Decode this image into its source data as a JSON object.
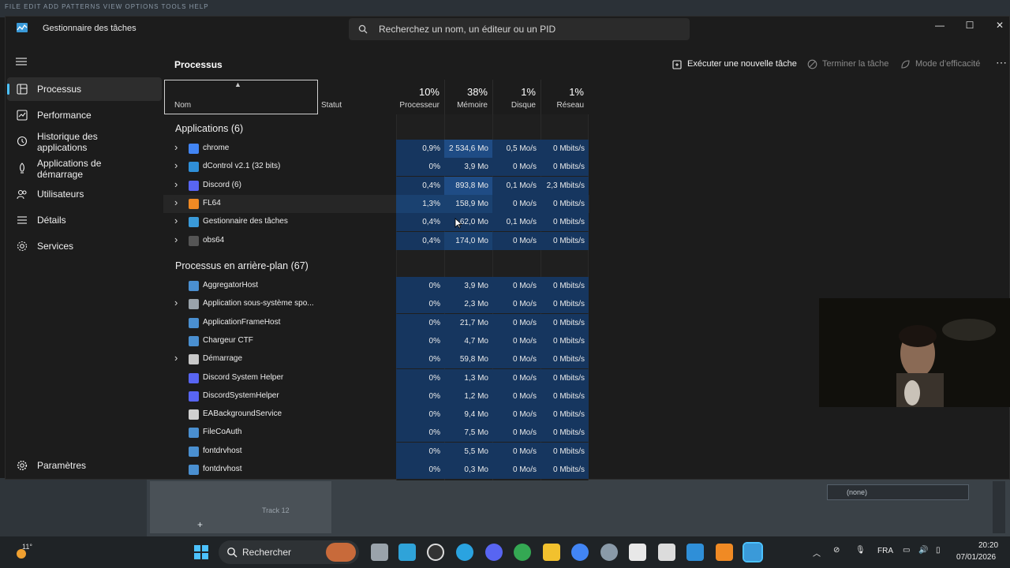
{
  "window": {
    "title": "Gestionnaire des tâches"
  },
  "search": {
    "placeholder": "Recherchez un nom, un éditeur ou un PID"
  },
  "sidebar": {
    "items": [
      {
        "label": "Processus",
        "icon": "processes-icon"
      },
      {
        "label": "Performance",
        "icon": "performance-icon"
      },
      {
        "label": "Historique des applications",
        "icon": "history-icon"
      },
      {
        "label": "Applications de démarrage",
        "icon": "startup-icon"
      },
      {
        "label": "Utilisateurs",
        "icon": "users-icon"
      },
      {
        "label": "Détails",
        "icon": "details-icon"
      },
      {
        "label": "Services",
        "icon": "services-icon"
      }
    ],
    "settings": "Paramètres"
  },
  "page": {
    "title": "Processus",
    "new_task": "Exécuter une nouvelle tâche",
    "end_task": "Terminer la tâche",
    "efficiency": "Mode d’efficacité"
  },
  "columns": {
    "name": "Nom",
    "status": "Statut",
    "cpu_pct": "10%",
    "cpu": "Processeur",
    "mem_pct": "38%",
    "mem": "Mémoire",
    "disk_pct": "1%",
    "disk": "Disque",
    "net_pct": "1%",
    "net": "Réseau"
  },
  "groups": {
    "apps": "Applications (6)",
    "background": "Processus en arrière-plan (67)"
  },
  "apps": [
    {
      "name": "chrome",
      "cpu": "0,9%",
      "mem": "2 534,6 Mo",
      "disk": "0,5 Mo/s",
      "net": "0 Mbits/s",
      "color": "#4285f4"
    },
    {
      "name": "dControl v2.1 (32 bits)",
      "cpu": "0%",
      "mem": "3,9 Mo",
      "disk": "0 Mo/s",
      "net": "0 Mbits/s",
      "color": "#2f8fd8"
    },
    {
      "name": "Discord (6)",
      "cpu": "0,4%",
      "mem": "893,8 Mo",
      "disk": "0,1 Mo/s",
      "net": "2,3 Mbits/s",
      "color": "#5865f2"
    },
    {
      "name": "FL64",
      "cpu": "1,3%",
      "mem": "158,9 Mo",
      "disk": "0 Mo/s",
      "net": "0 Mbits/s",
      "color": "#f08a24"
    },
    {
      "name": "Gestionnaire des tâches",
      "cpu": "0,4%",
      "mem": "62,0 Mo",
      "disk": "0,1 Mo/s",
      "net": "0 Mbits/s",
      "color": "#3a9ad9"
    },
    {
      "name": "obs64",
      "cpu": "0,4%",
      "mem": "174,0 Mo",
      "disk": "0 Mo/s",
      "net": "0 Mbits/s",
      "color": "#555"
    }
  ],
  "background": [
    {
      "name": "AggregatorHost",
      "cpu": "0%",
      "mem": "3,9 Mo",
      "disk": "0 Mo/s",
      "net": "0 Mbits/s",
      "color": "#4a8fd0"
    },
    {
      "name": "Application sous-système spo...",
      "cpu": "0%",
      "mem": "2,3 Mo",
      "disk": "0 Mo/s",
      "net": "0 Mbits/s",
      "color": "#9aa3ab"
    },
    {
      "name": "ApplicationFrameHost",
      "cpu": "0%",
      "mem": "21,7 Mo",
      "disk": "0 Mo/s",
      "net": "0 Mbits/s",
      "color": "#4a8fd0"
    },
    {
      "name": "Chargeur CTF",
      "cpu": "0%",
      "mem": "4,7 Mo",
      "disk": "0 Mo/s",
      "net": "0 Mbits/s",
      "color": "#4a8fd0"
    },
    {
      "name": "Démarrage",
      "cpu": "0%",
      "mem": "59,8 Mo",
      "disk": "0 Mo/s",
      "net": "0 Mbits/s",
      "color": "#c8c8c8"
    },
    {
      "name": "Discord System Helper",
      "cpu": "0%",
      "mem": "1,3 Mo",
      "disk": "0 Mo/s",
      "net": "0 Mbits/s",
      "color": "#5865f2"
    },
    {
      "name": "DiscordSystemHelper",
      "cpu": "0%",
      "mem": "1,2 Mo",
      "disk": "0 Mo/s",
      "net": "0 Mbits/s",
      "color": "#5865f2"
    },
    {
      "name": "EABackgroundService",
      "cpu": "0%",
      "mem": "9,4 Mo",
      "disk": "0 Mo/s",
      "net": "0 Mbits/s",
      "color": "#d0d0d0"
    },
    {
      "name": "FileCoAuth",
      "cpu": "0%",
      "mem": "7,5 Mo",
      "disk": "0 Mo/s",
      "net": "0 Mbits/s",
      "color": "#4a8fd0"
    },
    {
      "name": "fontdrvhost",
      "cpu": "0%",
      "mem": "5,5 Mo",
      "disk": "0 Mo/s",
      "net": "0 Mbits/s",
      "color": "#4a8fd0"
    },
    {
      "name": "fontdrvhost",
      "cpu": "0%",
      "mem": "0,3 Mo",
      "disk": "0 Mo/s",
      "net": "0 Mbits/s",
      "color": "#4a8fd0"
    }
  ],
  "bg_app": {
    "track": "Track 12",
    "none": "(none)"
  },
  "taskbar": {
    "weather": "11°",
    "search": "Rechercher",
    "lang": "FRA",
    "time": "20:20",
    "date": "07/01/2026"
  },
  "colors": {
    "accent": "#4cc2ff",
    "heat_low": "#16365f",
    "heat_mid": "#1f4c85"
  }
}
